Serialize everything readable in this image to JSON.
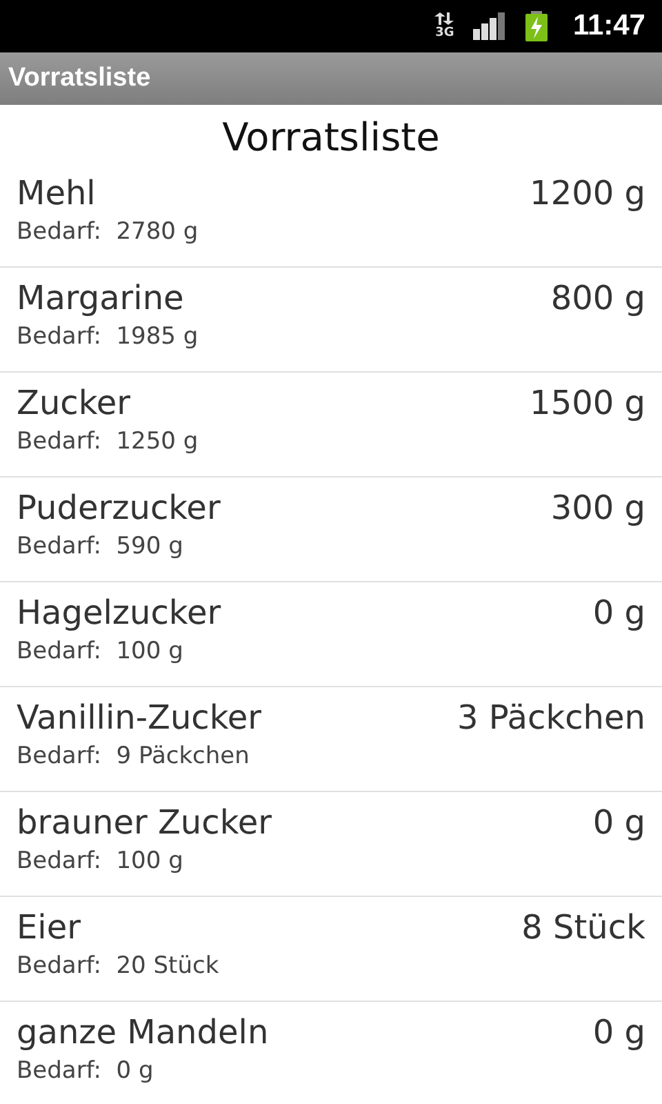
{
  "status_bar": {
    "network": "3G",
    "time": "11:47"
  },
  "window": {
    "title": "Vorratsliste"
  },
  "heading": "Vorratsliste",
  "items": [
    {
      "name": "Mehl",
      "amount": "1200 g",
      "need": "Bedarf:  2780 g"
    },
    {
      "name": "Margarine",
      "amount": "800 g",
      "need": "Bedarf:  1985 g"
    },
    {
      "name": "Zucker",
      "amount": "1500 g",
      "need": "Bedarf:  1250 g"
    },
    {
      "name": "Puderzucker",
      "amount": "300 g",
      "need": "Bedarf:  590 g"
    },
    {
      "name": "Hagelzucker",
      "amount": "0 g",
      "need": "Bedarf:  100 g"
    },
    {
      "name": "Vanillin-Zucker",
      "amount": "3 Päckchen",
      "need": "Bedarf:  9 Päckchen"
    },
    {
      "name": "brauner Zucker",
      "amount": "0 g",
      "need": "Bedarf:  100 g"
    },
    {
      "name": "Eier",
      "amount": "8 Stück",
      "need": "Bedarf:  20 Stück"
    },
    {
      "name": "ganze Mandeln",
      "amount": "0 g",
      "need": "Bedarf:  0 g"
    }
  ]
}
